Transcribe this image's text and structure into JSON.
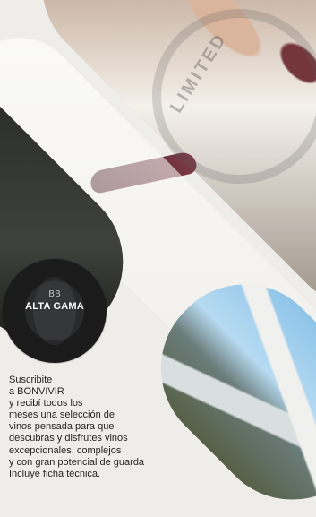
{
  "badge": {
    "logo": "BB",
    "title": "ALTA GAMA"
  },
  "promo_lines": [
    "Suscribite",
    "a BONVIVIR",
    "y recibí todos los",
    "meses una selección de",
    "vinos pensada para que",
    "descubras y disfrutes vinos",
    "excepcionales, complejos",
    "y con gran potencial de guarda",
    "Incluye ficha técnica."
  ],
  "background_text": {
    "seal": "LIMITED"
  },
  "colors": {
    "page": "#eeede9",
    "badge": "#1b1b1c",
    "text": "#252525"
  }
}
